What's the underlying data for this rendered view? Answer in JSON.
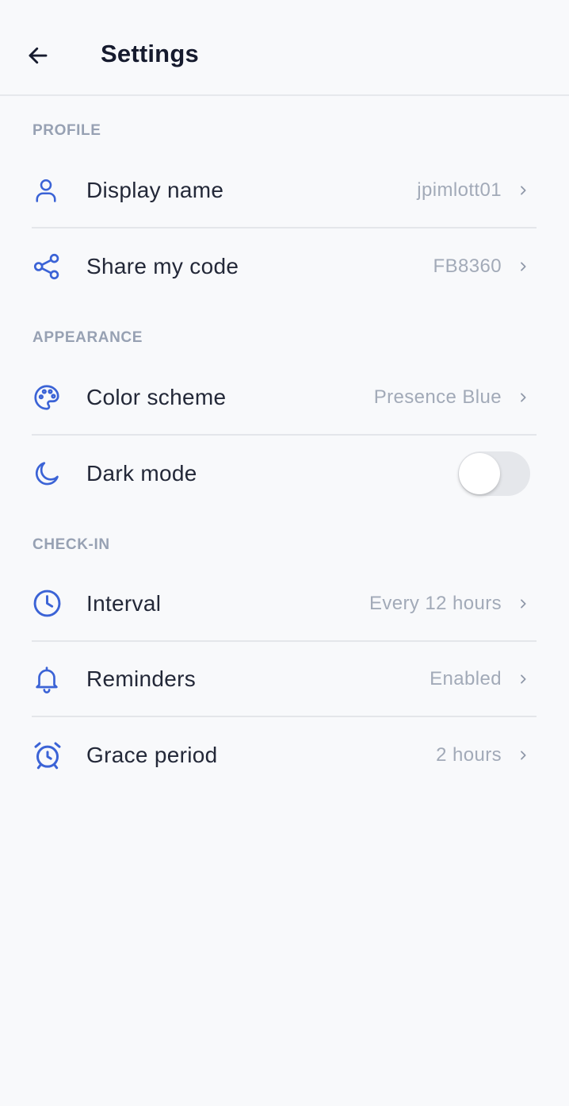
{
  "header": {
    "title": "Settings",
    "back_icon": "arrow-left-icon"
  },
  "colors": {
    "accent": "#3b63d6",
    "title": "#161b2e",
    "label": "#232838",
    "value": "#a2aab8",
    "section": "#97a1b3",
    "divider": "#e4e6ea",
    "background": "#f8f9fb"
  },
  "sections": {
    "profile": {
      "label": "PROFILE",
      "display_name": {
        "label": "Display name",
        "value": "jpimlott01",
        "icon": "user-icon"
      },
      "share_code": {
        "label": "Share my code",
        "value": "FB8360",
        "icon": "share-icon"
      }
    },
    "appearance": {
      "label": "APPEARANCE",
      "color_scheme": {
        "label": "Color scheme",
        "value": "Presence Blue",
        "icon": "palette-icon"
      },
      "dark_mode": {
        "label": "Dark mode",
        "enabled": false,
        "icon": "moon-icon"
      }
    },
    "checkin": {
      "label": "CHECK-IN",
      "interval": {
        "label": "Interval",
        "value": "Every 12 hours",
        "icon": "clock-icon"
      },
      "reminders": {
        "label": "Reminders",
        "value": "Enabled",
        "icon": "bell-icon"
      },
      "grace_period": {
        "label": "Grace period",
        "value": "2 hours",
        "icon": "alarm-clock-icon"
      }
    }
  }
}
